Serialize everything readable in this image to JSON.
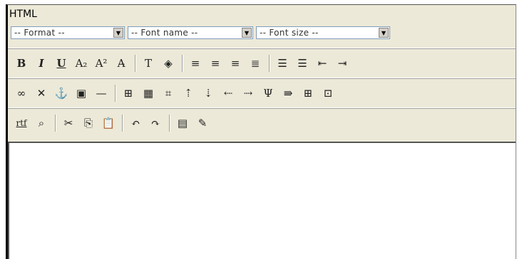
{
  "editor": {
    "mode_label": "HTML",
    "selects": {
      "format": "-- Format --",
      "font_name": "-- Font name --",
      "font_size": "-- Font size --"
    },
    "toolbar1": [
      {
        "name": "bold-button",
        "glyph": "B"
      },
      {
        "name": "italic-button",
        "glyph": "I"
      },
      {
        "name": "underline-button",
        "glyph": "U"
      },
      {
        "name": "subscript-button",
        "glyph": "A₂"
      },
      {
        "name": "superscript-button",
        "glyph": "A²"
      },
      {
        "name": "strikethrough-button",
        "glyph": "A̶"
      },
      {
        "sep": true
      },
      {
        "name": "text-color-button",
        "glyph": "T"
      },
      {
        "name": "background-color-button",
        "glyph": "◈"
      },
      {
        "sep": true
      },
      {
        "name": "align-left-button",
        "glyph": "≡"
      },
      {
        "name": "align-center-button",
        "glyph": "≡"
      },
      {
        "name": "align-right-button",
        "glyph": "≡"
      },
      {
        "name": "justify-button",
        "glyph": "≣"
      },
      {
        "sep": true
      },
      {
        "name": "unordered-list-button",
        "glyph": "☰"
      },
      {
        "name": "ordered-list-button",
        "glyph": "☰"
      },
      {
        "name": "outdent-button",
        "glyph": "⇤"
      },
      {
        "name": "indent-button",
        "glyph": "⇥"
      }
    ],
    "toolbar2": [
      {
        "name": "insert-link-button",
        "glyph": "∞"
      },
      {
        "name": "remove-link-button",
        "glyph": "✕"
      },
      {
        "name": "anchor-button",
        "glyph": "⚓"
      },
      {
        "name": "insert-image-button",
        "glyph": "▣"
      },
      {
        "name": "horizontal-rule-button",
        "glyph": "—"
      },
      {
        "sep": true
      },
      {
        "name": "insert-table-button",
        "glyph": "⊞"
      },
      {
        "name": "table-properties-button",
        "glyph": "▦"
      },
      {
        "name": "cell-properties-button",
        "glyph": "⌗"
      },
      {
        "name": "insert-row-before-button",
        "glyph": "⇡"
      },
      {
        "name": "insert-row-after-button",
        "glyph": "⇣"
      },
      {
        "name": "insert-column-before-button",
        "glyph": "⇠"
      },
      {
        "name": "insert-column-after-button",
        "glyph": "⇢"
      },
      {
        "name": "delete-row-button",
        "glyph": "Ψ"
      },
      {
        "name": "delete-column-button",
        "glyph": "⇛"
      },
      {
        "name": "split-cell-button",
        "glyph": "⊞"
      },
      {
        "name": "merge-cells-button",
        "glyph": "⊡"
      }
    ],
    "toolbar3": [
      {
        "name": "paste-rtf-button",
        "glyph": "rtf"
      },
      {
        "name": "find-button",
        "glyph": "⌕"
      },
      {
        "sep": true
      },
      {
        "name": "cut-button",
        "glyph": "✂"
      },
      {
        "name": "copy-button",
        "glyph": "⎘"
      },
      {
        "name": "paste-button",
        "glyph": "📋"
      },
      {
        "sep": true
      },
      {
        "name": "undo-button",
        "glyph": "↶"
      },
      {
        "name": "redo-button",
        "glyph": "↷"
      },
      {
        "sep": true
      },
      {
        "name": "select-all-button",
        "glyph": "▤"
      },
      {
        "name": "edit-source-button",
        "glyph": "✎"
      }
    ]
  }
}
